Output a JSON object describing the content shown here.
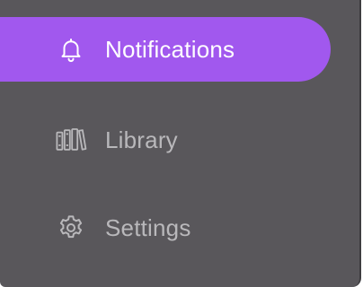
{
  "nav": {
    "items": [
      {
        "label": "Notifications",
        "icon": "bell-icon",
        "active": true
      },
      {
        "label": "Library",
        "icon": "books-icon",
        "active": false
      },
      {
        "label": "Settings",
        "icon": "gear-icon",
        "active": false
      }
    ]
  },
  "colors": {
    "panel_bg": "#59575b",
    "active_bg": "#a158ee",
    "active_text": "#ffffff",
    "inactive_text": "#b9b8bb"
  }
}
